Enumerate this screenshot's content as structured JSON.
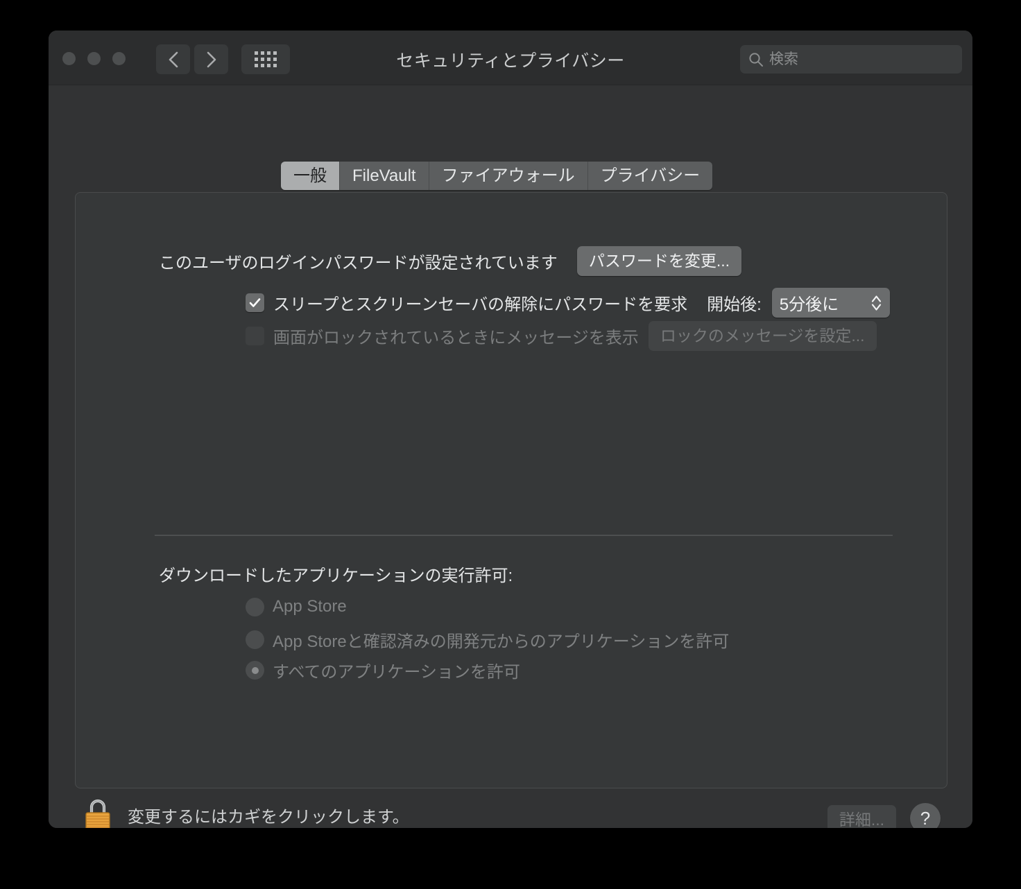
{
  "window": {
    "title": "セキュリティとプライバシー",
    "traffic_lights": [
      "close",
      "minimize",
      "zoom"
    ]
  },
  "toolbar": {
    "back_icon": "chevron-left-icon",
    "forward_icon": "chevron-right-icon",
    "grid_icon": "grid-view-icon",
    "search": {
      "icon": "search-icon",
      "value": "",
      "placeholder": "検索"
    }
  },
  "tabs": [
    {
      "label": "一般",
      "selected": true
    },
    {
      "label": "FileVault",
      "selected": false
    },
    {
      "label": "ファイアウォール",
      "selected": false
    },
    {
      "label": "プライバシー",
      "selected": false
    }
  ],
  "general": {
    "password_status": "このユーザのログインパスワードが設定されています",
    "change_password_button": "パスワードを変更...",
    "require_password": {
      "checked": true,
      "label": "スリープとスクリーンセーバの解除にパスワードを要求",
      "after_label": "開始後:",
      "delay_value": "5分後に"
    },
    "lock_message": {
      "checked": false,
      "enabled": false,
      "label": "画面がロックされているときにメッセージを表示",
      "set_button": "ロックのメッセージを設定..."
    },
    "downloads": {
      "title": "ダウンロードしたアプリケーションの実行許可:",
      "options": [
        {
          "label": "App Store",
          "selected": false
        },
        {
          "label": "App Storeと確認済みの開発元からのアプリケーションを許可",
          "selected": false
        },
        {
          "label": "すべてのアプリケーションを許可",
          "selected": true
        }
      ]
    }
  },
  "footer": {
    "lock_icon": "padlock-closed-icon",
    "lock_text": "変更するにはカギをクリックします。",
    "advanced_button": "詳細...",
    "help_button": "?"
  },
  "colors": {
    "window_bg": "#323334",
    "titlebar_bg": "#2c2d2e",
    "panel_bg": "#363839",
    "tab_selected_bg": "#abadae",
    "lock_gold": "#e8a33d"
  }
}
